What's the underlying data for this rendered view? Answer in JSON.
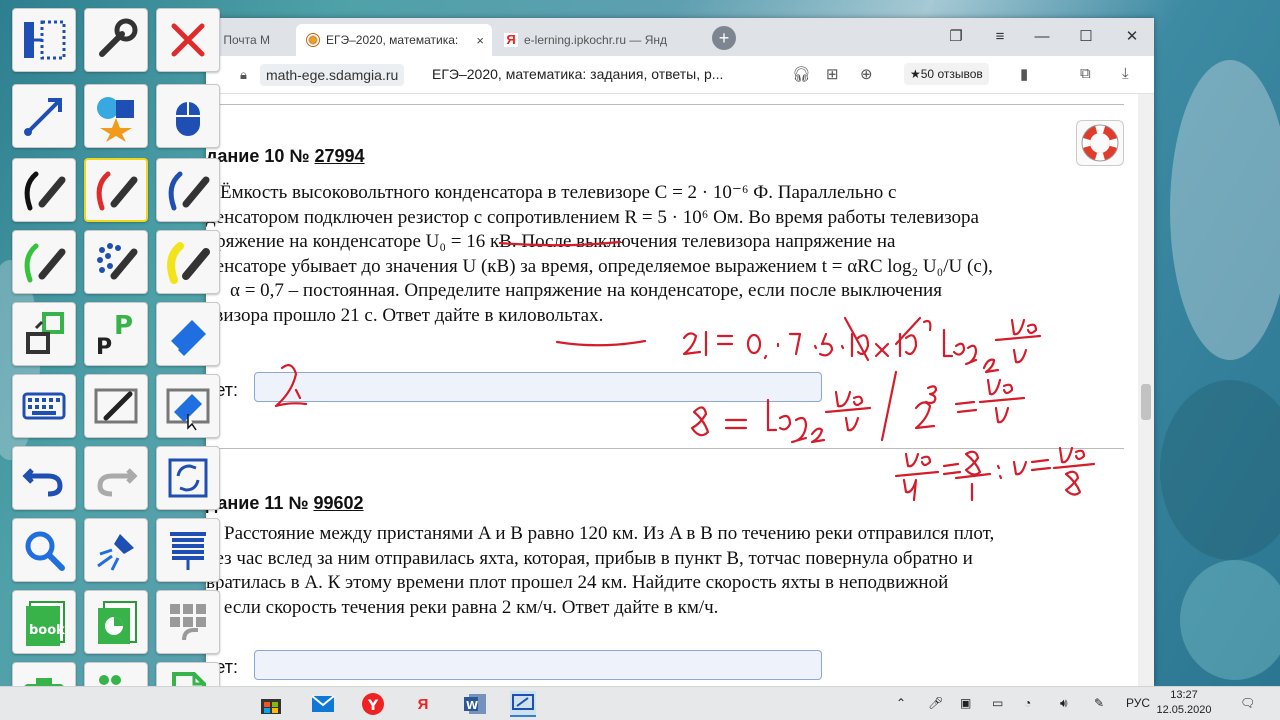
{
  "browser": {
    "tabs": [
      {
        "label": "- Почта M"
      },
      {
        "label": "ЕГЭ–2020, математика:",
        "close": "×"
      },
      {
        "label": "e-lerning.ipkochr.ru — Янд"
      }
    ],
    "new_tab": "+",
    "address": {
      "domain": "math-ege.sdamgia.ru",
      "title": "ЕГЭ–2020, математика: задания, ответы, р...",
      "reviews": "★50 отзывов"
    }
  },
  "task10": {
    "head_prefix": "дание 10 №",
    "number": "27994",
    "lines": [
      "Ёмкость высоковольтного конденсатора в телевизоре C = 2 · 10⁻⁶ Ф. Параллельно с",
      "денсатором подключен резистор с сопротивлением R = 5 · 10⁶ Ом. Во время работы телевизора",
      "пряжение на конденсаторе U₀ = 16 кВ. После выключения телевизора напряжение на",
      "денсаторе убывает до значения U (кВ) за время, определяемое выражением t = αRC log₂ U₀/U (с),",
      "α = 0,7 – постоянная. Определите напряжение на конденсаторе, если после выключения",
      "евизора прошло 21 с. Ответ дайте в киловольтах."
    ],
    "answer_label": "вет:"
  },
  "task11": {
    "head_prefix": "дание 11 №",
    "number": "99602",
    "lines": [
      "Расстояние между пристанями A и B равно 120 км. Из A в B по течению реки отправился плот,",
      "рез час вслед за ним отправилась яхта, которая, прибыв в пункт B, тотчас повернула обратно и",
      "вратилась в A. К этому времени плот прошел 24 км. Найдите скорость яхты в неподвижной",
      "е, если скорость течения реки равна 2 км/ч. Ответ дайте в км/ч."
    ],
    "answer_label": "вет:"
  },
  "palette_tools": [
    "page-sorter-icon",
    "settings-wrench-icon",
    "close-red-x-icon",
    "line-arrow-icon",
    "shapes-icon",
    "mouse-select-icon",
    "pen-black-icon",
    "pen-red-icon",
    "pen-blue-icon",
    "pen-green-icon",
    "stamp-pen-icon",
    "highlighter-yellow-icon",
    "fill-shape-icon",
    "text-pen-icon",
    "eraser-icon",
    "keyboard-icon",
    "screen-annotate-icon",
    "erase-screen-icon",
    "undo-icon",
    "redo-icon",
    "refresh-icon",
    "magnifier-icon",
    "spotlight-icon",
    "screen-shade-icon",
    "ebook-icon",
    "presentation-icon",
    "toolbox-icon",
    "camera-icon",
    "video-camera-icon",
    "document-icon"
  ],
  "taskbar": {
    "language": "РУС",
    "time": "13:27",
    "date": "12.05.2020"
  },
  "colors": {
    "ink_red": "#d51c2a",
    "palette_selected": "#f1d71c"
  }
}
